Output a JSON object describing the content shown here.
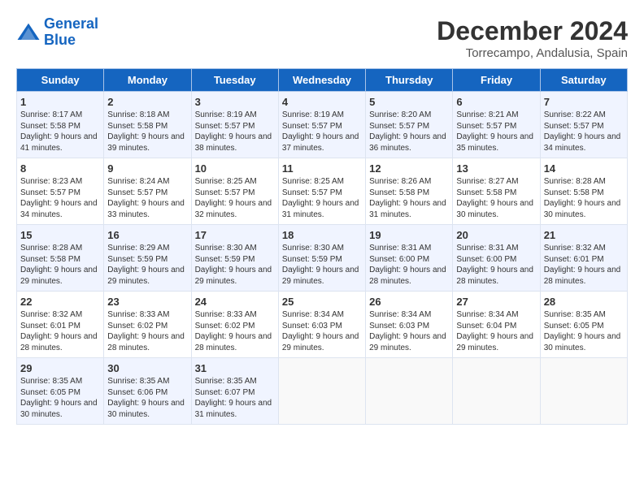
{
  "header": {
    "logo_line1": "General",
    "logo_line2": "Blue",
    "month_title": "December 2024",
    "location": "Torrecampo, Andalusia, Spain"
  },
  "days_of_week": [
    "Sunday",
    "Monday",
    "Tuesday",
    "Wednesday",
    "Thursday",
    "Friday",
    "Saturday"
  ],
  "weeks": [
    [
      {
        "day": "1",
        "sunrise": "8:17 AM",
        "sunset": "5:58 PM",
        "daylight": "9 hours and 41 minutes."
      },
      {
        "day": "2",
        "sunrise": "8:18 AM",
        "sunset": "5:58 PM",
        "daylight": "9 hours and 39 minutes."
      },
      {
        "day": "3",
        "sunrise": "8:19 AM",
        "sunset": "5:57 PM",
        "daylight": "9 hours and 38 minutes."
      },
      {
        "day": "4",
        "sunrise": "8:19 AM",
        "sunset": "5:57 PM",
        "daylight": "9 hours and 37 minutes."
      },
      {
        "day": "5",
        "sunrise": "8:20 AM",
        "sunset": "5:57 PM",
        "daylight": "9 hours and 36 minutes."
      },
      {
        "day": "6",
        "sunrise": "8:21 AM",
        "sunset": "5:57 PM",
        "daylight": "9 hours and 35 minutes."
      },
      {
        "day": "7",
        "sunrise": "8:22 AM",
        "sunset": "5:57 PM",
        "daylight": "9 hours and 34 minutes."
      }
    ],
    [
      {
        "day": "8",
        "sunrise": "8:23 AM",
        "sunset": "5:57 PM",
        "daylight": "9 hours and 34 minutes."
      },
      {
        "day": "9",
        "sunrise": "8:24 AM",
        "sunset": "5:57 PM",
        "daylight": "9 hours and 33 minutes."
      },
      {
        "day": "10",
        "sunrise": "8:25 AM",
        "sunset": "5:57 PM",
        "daylight": "9 hours and 32 minutes."
      },
      {
        "day": "11",
        "sunrise": "8:25 AM",
        "sunset": "5:57 PM",
        "daylight": "9 hours and 31 minutes."
      },
      {
        "day": "12",
        "sunrise": "8:26 AM",
        "sunset": "5:58 PM",
        "daylight": "9 hours and 31 minutes."
      },
      {
        "day": "13",
        "sunrise": "8:27 AM",
        "sunset": "5:58 PM",
        "daylight": "9 hours and 30 minutes."
      },
      {
        "day": "14",
        "sunrise": "8:28 AM",
        "sunset": "5:58 PM",
        "daylight": "9 hours and 30 minutes."
      }
    ],
    [
      {
        "day": "15",
        "sunrise": "8:28 AM",
        "sunset": "5:58 PM",
        "daylight": "9 hours and 29 minutes."
      },
      {
        "day": "16",
        "sunrise": "8:29 AM",
        "sunset": "5:59 PM",
        "daylight": "9 hours and 29 minutes."
      },
      {
        "day": "17",
        "sunrise": "8:30 AM",
        "sunset": "5:59 PM",
        "daylight": "9 hours and 29 minutes."
      },
      {
        "day": "18",
        "sunrise": "8:30 AM",
        "sunset": "5:59 PM",
        "daylight": "9 hours and 29 minutes."
      },
      {
        "day": "19",
        "sunrise": "8:31 AM",
        "sunset": "6:00 PM",
        "daylight": "9 hours and 28 minutes."
      },
      {
        "day": "20",
        "sunrise": "8:31 AM",
        "sunset": "6:00 PM",
        "daylight": "9 hours and 28 minutes."
      },
      {
        "day": "21",
        "sunrise": "8:32 AM",
        "sunset": "6:01 PM",
        "daylight": "9 hours and 28 minutes."
      }
    ],
    [
      {
        "day": "22",
        "sunrise": "8:32 AM",
        "sunset": "6:01 PM",
        "daylight": "9 hours and 28 minutes."
      },
      {
        "day": "23",
        "sunrise": "8:33 AM",
        "sunset": "6:02 PM",
        "daylight": "9 hours and 28 minutes."
      },
      {
        "day": "24",
        "sunrise": "8:33 AM",
        "sunset": "6:02 PM",
        "daylight": "9 hours and 28 minutes."
      },
      {
        "day": "25",
        "sunrise": "8:34 AM",
        "sunset": "6:03 PM",
        "daylight": "9 hours and 29 minutes."
      },
      {
        "day": "26",
        "sunrise": "8:34 AM",
        "sunset": "6:03 PM",
        "daylight": "9 hours and 29 minutes."
      },
      {
        "day": "27",
        "sunrise": "8:34 AM",
        "sunset": "6:04 PM",
        "daylight": "9 hours and 29 minutes."
      },
      {
        "day": "28",
        "sunrise": "8:35 AM",
        "sunset": "6:05 PM",
        "daylight": "9 hours and 30 minutes."
      }
    ],
    [
      {
        "day": "29",
        "sunrise": "8:35 AM",
        "sunset": "6:05 PM",
        "daylight": "9 hours and 30 minutes."
      },
      {
        "day": "30",
        "sunrise": "8:35 AM",
        "sunset": "6:06 PM",
        "daylight": "9 hours and 30 minutes."
      },
      {
        "day": "31",
        "sunrise": "8:35 AM",
        "sunset": "6:07 PM",
        "daylight": "9 hours and 31 minutes."
      },
      null,
      null,
      null,
      null
    ]
  ]
}
